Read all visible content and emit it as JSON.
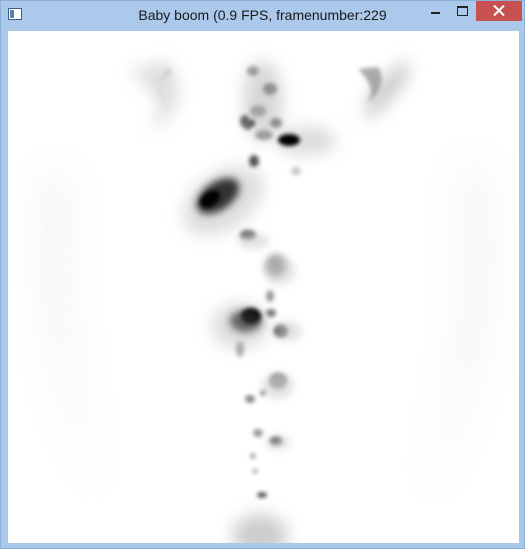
{
  "window": {
    "title": "Baby boom (0.9 FPS, framenumber:229",
    "controls": {
      "minimize": "minimize",
      "maximize": "maximize",
      "close": "close"
    }
  },
  "icons": {
    "app": "app-window-icon",
    "minimize": "minimize-icon",
    "maximize": "maximize-icon",
    "close": "close-icon"
  },
  "colors": {
    "titlebar": "#abc9eb",
    "close_button": "#c75050",
    "canvas_background": "#ffffff",
    "blob_dark": "#000000"
  }
}
